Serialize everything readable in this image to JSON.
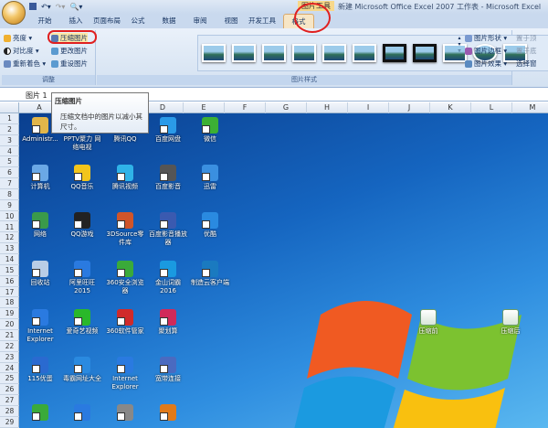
{
  "window": {
    "context_title": "图片工具",
    "title": "新建 Microsoft Office Excel 2007 工作表 - Microsoft Excel"
  },
  "tabs": [
    "开始",
    "插入",
    "页面布局",
    "公式",
    "数据",
    "审阅",
    "视图",
    "开发工具",
    "格式"
  ],
  "ribbon": {
    "adjust": {
      "label": "调整",
      "items": [
        "亮度 ▾",
        "对比度 ▾",
        "重新着色 ▾",
        "压缩图片",
        "更改图片",
        "重设图片"
      ]
    },
    "styles": {
      "label": "图片样式",
      "items": [
        "图片形状 ▾",
        "图片边框 ▾",
        "图片效果 ▾"
      ]
    },
    "arrange": {
      "items": [
        "置于顶",
        "置于底",
        "选择窗"
      ]
    }
  },
  "namebox": "图片 1",
  "tooltip": {
    "title": "压缩图片",
    "body": "压缩文档中的图片以减小其尺寸。"
  },
  "columns": [
    "A",
    "B",
    "C",
    "D",
    "E",
    "F",
    "G",
    "H",
    "I",
    "J",
    "K",
    "L",
    "M"
  ],
  "rows": [
    "1",
    "2",
    "3",
    "4",
    "5",
    "6",
    "7",
    "8",
    "9",
    "10",
    "11",
    "12",
    "13",
    "14",
    "15",
    "16",
    "17",
    "18",
    "19",
    "20",
    "21",
    "22",
    "23",
    "24",
    "25",
    "26",
    "27",
    "28",
    "29"
  ],
  "desktop_icons": [
    {
      "label": "Administr...",
      "color": "#e2b64a"
    },
    {
      "label": "PPTV聚力 网络电视",
      "color": "#1d8fe0"
    },
    {
      "label": "腾讯QQ",
      "color": "#222"
    },
    {
      "label": "百度网盘",
      "color": "#2a9ae8"
    },
    {
      "label": "微信",
      "color": "#3cb034"
    },
    {
      "label": "计算机",
      "color": "#6aa8e6"
    },
    {
      "label": "QQ音乐",
      "color": "#f2c51c"
    },
    {
      "label": "腾讯视频",
      "color": "#2fb3e8"
    },
    {
      "label": "百度影音",
      "color": "#555"
    },
    {
      "label": "迅雷",
      "color": "#3a8fe0"
    },
    {
      "label": "网络",
      "color": "#3a9a4a"
    },
    {
      "label": "QQ游戏",
      "color": "#222"
    },
    {
      "label": "3DSource零件库",
      "color": "#d0552a"
    },
    {
      "label": "百度影音播放器",
      "color": "#3a5ab0"
    },
    {
      "label": "优酷",
      "color": "#2a8ae0"
    },
    {
      "label": "回收站",
      "color": "#b8cde6"
    },
    {
      "label": "阿里旺旺 2015",
      "color": "#2a7ae0"
    },
    {
      "label": "360安全浏览器",
      "color": "#3aaa3a"
    },
    {
      "label": "金山词霸 2016",
      "color": "#1a9ae0"
    },
    {
      "label": "制造云客户端",
      "color": "#1a7ac0"
    },
    {
      "label": "Internet Explorer",
      "color": "#2a7ae0"
    },
    {
      "label": "爱奇艺视频",
      "color": "#2ab82a"
    },
    {
      "label": "360软件管家",
      "color": "#d02a2a"
    },
    {
      "label": "聚划算",
      "color": "#d02a5a"
    },
    {
      "label": "",
      "color": ""
    },
    {
      "label": "115优蛋",
      "color": "#2a6ad0"
    },
    {
      "label": "毒霸网址大全",
      "color": "#2a8ae0"
    },
    {
      "label": "Internet Explorer",
      "color": "#2a7ae0"
    },
    {
      "label": "宽带连接",
      "color": "#4a6ac0"
    },
    {
      "label": "",
      "color": ""
    },
    {
      "label": "",
      "color": "#3aaa3a"
    },
    {
      "label": "",
      "color": "#2a7ae0"
    },
    {
      "label": "",
      "color": "#888"
    },
    {
      "label": "",
      "color": "#e07a1a"
    }
  ],
  "desktop_files": [
    {
      "label": "压缩前"
    },
    {
      "label": "压缩后"
    }
  ]
}
